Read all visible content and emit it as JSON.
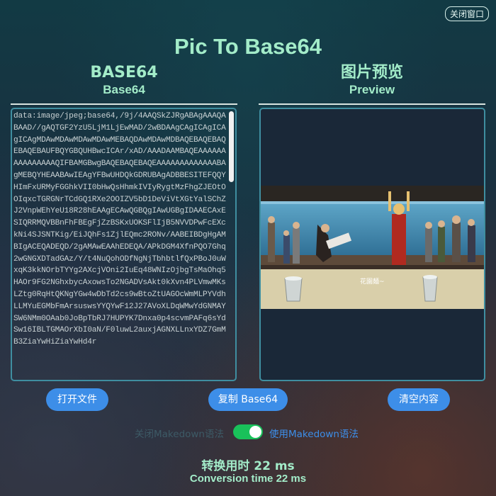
{
  "window": {
    "close_label": "关闭窗口"
  },
  "title": "Pic To Base64",
  "left_column": {
    "heading_zh": "BASE64",
    "heading_en": "Base64"
  },
  "right_column": {
    "heading_zh": "图片预览",
    "heading_en": "Preview"
  },
  "base64_text": "data:image/jpeg;base64,/9j/4AAQSkZJRgABAgAAAQABAAD//gAQTGF2YzU5LjM1LjEwMAD/2wBDAAgCAgICAgICAgICAgMDAwMDAwMDAwMDAwMEBAQDAwMDAwMDBAQEBAQEBAQEBAQEBAUFBQYGBQUHBwcICAr/xAD/AAADAAMBAQEAAAAAAAAAAAAAAAQIFBAMGBwgBAQEBAQEBAQEAAAAAAAAAAAAABAgMEBQYHEAABAwIEAgYFBwUHDQkGDRUBAgADBBESITEFQQYHImFxURMyFGGhkVII0bHwQsHhmkIVIyRygtMzFhgZJEOtOOIqxcTGRGNrTCdGQ1RXe2OOIZV5bD1DeViVtXGtYalSChZJ2VnpWEhYeU18R28hEAAgECAwQGBQgIAwUGBgIDAAECAxESIQRRMQVBBnFhFBEgFjZzBSKxUOKSFlIjB5NVVDPwFcEXckNi4SJSNTKig/EiJQhFs1ZjlEQmc2RONv/AABEIBDgHgAMBIgACEQADEQD/2gAMAwEAAhEDEQA/APkDGM4XfnPQO7Ghq2wGNGXDTadGAz/Y/t4NuQohODfNgNjTbhbtlfQxPBoJ0uWxqK3kkNOrbTYYg2AXcjVOni2IuEq48WNIzOjbgTsMaOhq5HAOr9FG2NGhxbycAxowsTo2NGADVsAkt0kXvn4PLVmwMKsLZtg0RqHtQKNgYGw4wDbTd2cs9wBtoZtUAGOcWmMLPYVdhLLMYuEGMbFmArsuswsYYQYwF12J27AVoXLDqWMwYdGNMAYSW6NMm0OAab0JoBpTbRJ7HUPYK7Dnxa0p4scvmPAFq6sYdSw16IBLTGMAOrXbI0aN/F0luwL2auxjAGNXLLnxYDZ7GmMB3ZiaYwHiZiaYwHd4r",
  "buttons": {
    "open": "打开文件",
    "copy": "复制 Base64",
    "clear": "清空内容"
  },
  "toggle": {
    "off_label": "关闭Makedown语法",
    "on_label": "使用Makedown语法",
    "state": true
  },
  "conversion": {
    "zh": "转换用时 22 ms",
    "en": "Conversion time 22 ms"
  },
  "preview": {
    "subtitle": "花園麺~"
  },
  "colors": {
    "accent": "#3d8ee8",
    "title": "#a3ecc9",
    "switch_on": "#19c15a",
    "border": "#3f8ea0"
  }
}
